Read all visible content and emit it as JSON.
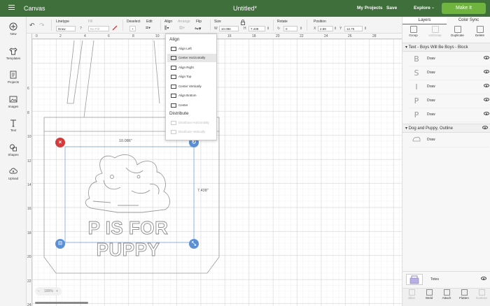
{
  "topbar": {
    "canvas_label": "Canvas",
    "title": "Untitled*",
    "my_projects": "My Projects",
    "save": "Save",
    "explore": "Explore",
    "make_it": "Make It"
  },
  "toolbar": {
    "linetype_label": "Linetype",
    "linetype_value": "Draw",
    "fill_label": "Fill",
    "fill_value": "No Fill",
    "deselect_label": "Deselect",
    "edit_label": "Edit",
    "align_label": "Align",
    "arrange_label": "Arrange",
    "flip_label": "Flip",
    "size_label": "Size",
    "size_w_label": "W",
    "size_w_value": "10.086",
    "size_h_label": "H",
    "size_h_value": "7.438",
    "rotate_label": "Rotate",
    "rotate_value": "0",
    "position_label": "Position",
    "pos_x_label": "X",
    "pos_x_value": "2.89",
    "pos_y_label": "Y",
    "pos_y_value": "12.75"
  },
  "leftbar": {
    "items": [
      "New",
      "Templates",
      "Projects",
      "Images",
      "Text",
      "Shapes",
      "Upload"
    ]
  },
  "ruler": {
    "top": [
      "0",
      "2",
      "4",
      "6",
      "8",
      "10",
      "12",
      "14",
      "16",
      "18",
      "20",
      "22",
      "24",
      "26",
      "28"
    ],
    "left": [
      "6",
      "8",
      "10",
      "12",
      "14",
      "16",
      "18",
      "20",
      "22",
      "24"
    ]
  },
  "canvas": {
    "dim_width": "10.086\"",
    "dim_height": "7.438\"",
    "puppy_text": "P IS FOR PUPPY",
    "zoom": "100%"
  },
  "align_menu": {
    "header": "Align",
    "items": [
      "Align Left",
      "Center Horizontally",
      "Align Right",
      "Align Top",
      "Center Vertically",
      "Align Bottom",
      "Center"
    ],
    "distribute_header": "Distribute",
    "distribute_items": [
      "Distribute Horizontally",
      "Distribute Vertically"
    ]
  },
  "rightpanel": {
    "tabs": [
      "Layers",
      "Color Sync"
    ],
    "tools": [
      "Group",
      "UnGroup",
      "Duplicate",
      "Delete"
    ],
    "group1_name": "Text - Boys Will Be Boys - Block",
    "group1_layers": [
      {
        "thumb": "B",
        "name": "Draw"
      },
      {
        "thumb": "S",
        "name": "Draw"
      },
      {
        "thumb": "I",
        "name": "Draw"
      },
      {
        "thumb": "P",
        "name": "Draw"
      },
      {
        "thumb": "P",
        "name": "Draw"
      }
    ],
    "group2_name": "Dog and Puppy, Outline",
    "group2_layers": [
      {
        "name": "Draw"
      }
    ],
    "bottom_layer_name": "Totes",
    "bottom_tools": [
      "Slice",
      "Weld",
      "Attach",
      "Flatten",
      "Contour"
    ]
  },
  "colors": {
    "topbar": "#3f6f3b",
    "make_it": "#6fb43f",
    "handle_delete": "#d63b3b",
    "handle_blue": "#5b8fd6"
  }
}
